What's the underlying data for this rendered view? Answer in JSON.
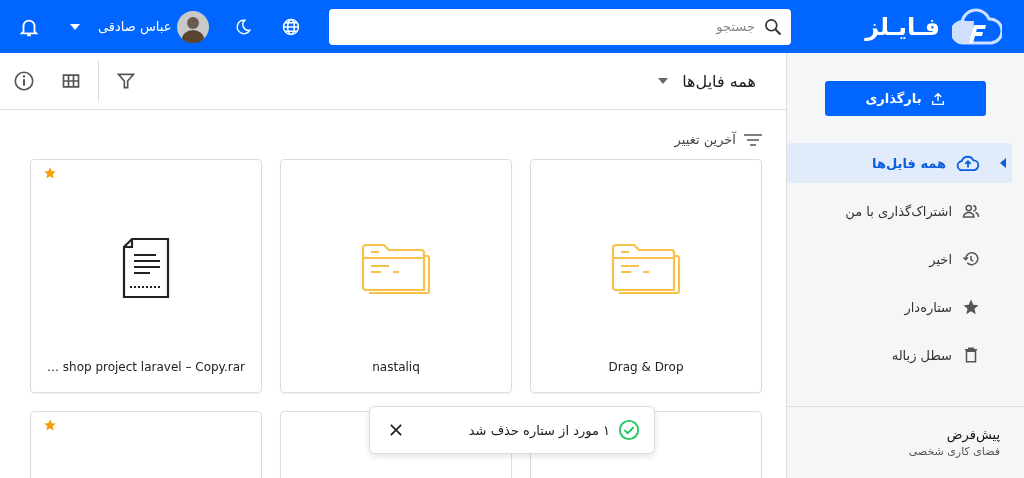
{
  "header": {
    "app_name": "فـایـلز",
    "search": {
      "placeholder": "جستجو"
    },
    "user": {
      "name": "عباس صادقی"
    }
  },
  "toolbar": {
    "title": "همه فایل‌ها"
  },
  "sort": {
    "label": "آخرین تغییر"
  },
  "files": [
    {
      "kind": "folder",
      "name": "Drag & Drop",
      "starred": false
    },
    {
      "kind": "folder",
      "name": "nastaliq",
      "starred": false
    },
    {
      "kind": "document",
      "name": "… shop project laravel – Copy.rar",
      "starred": true
    },
    {
      "kind": "blank",
      "starred": false
    },
    {
      "kind": "blank",
      "starred": false
    },
    {
      "kind": "blank",
      "starred": true
    }
  ],
  "sidebar": {
    "upload_button": "بارگذاری",
    "items": [
      {
        "label": "همه فایل‌ها",
        "selected": true
      },
      {
        "label": "اشتراک‌گذاری با من",
        "selected": false
      },
      {
        "label": "اخیر",
        "selected": false
      },
      {
        "label": "ستاره‌دار",
        "selected": false
      },
      {
        "label": "سطل زباله",
        "selected": false
      }
    ],
    "workspace": {
      "name": "پیش‌فرض",
      "subtitle": "فضای کاری شخصی"
    }
  },
  "toast": {
    "message": "۱ مورد از ستاره حذف شد"
  }
}
